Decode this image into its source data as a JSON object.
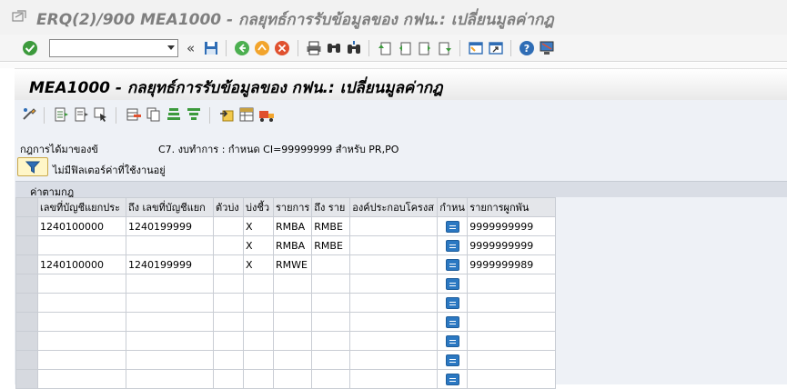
{
  "window": {
    "title": "ERQ(2)/900 MEA1000 - กลยุทธ์การรับข้อมูลของ กฟน.: เปลี่ยนมูลค่ากฎ"
  },
  "toolbar": {
    "command_field_value": "",
    "double_arrow": "«"
  },
  "screen": {
    "title": "MEA1000 - กลยุทธ์การรับข้อมูลของ กฟน.: เปลี่ยนมูลค่ากฎ"
  },
  "rule": {
    "label": "กฎการได้มาของข้",
    "value": "C7. งบทำการ : กำหนด CI=99999999 สำหรับ PR,PO"
  },
  "filter": {
    "text": "ไม่มีฟิลเตอร์ค่าที่ใช้งานอยู่"
  },
  "grid": {
    "title": "ค่าตามกฎ",
    "columns": [
      "เลขที่บัญชีแยกประ",
      "ถึง เลขที่บัญชีแยก",
      "ตัวบ่ง",
      "บ่งชี้ว",
      "รายการ",
      "ถึง ราย",
      "องค์ประกอบโครงส",
      "กำหน",
      "รายการผูกพัน"
    ],
    "rows": [
      [
        "1240100000",
        "1240199999",
        "",
        "X",
        "RMBA",
        "RMBE",
        "",
        "",
        "9999999999"
      ],
      [
        "",
        "",
        "",
        "X",
        "RMBA",
        "RMBE",
        "",
        "",
        "9999999999"
      ],
      [
        "1240100000",
        "1240199999",
        "",
        "X",
        "RMWE",
        "",
        "",
        "",
        "9999999989"
      ],
      [
        "",
        "",
        "",
        "",
        "",
        "",
        "",
        "",
        ""
      ],
      [
        "",
        "",
        "",
        "",
        "",
        "",
        "",
        "",
        ""
      ],
      [
        "",
        "",
        "",
        "",
        "",
        "",
        "",
        "",
        ""
      ],
      [
        "",
        "",
        "",
        "",
        "",
        "",
        "",
        "",
        ""
      ],
      [
        "",
        "",
        "",
        "",
        "",
        "",
        "",
        "",
        ""
      ],
      [
        "",
        "",
        "",
        "",
        "",
        "",
        "",
        "",
        ""
      ]
    ]
  },
  "colors": {
    "header_bg": "#f2f2f2",
    "panel_bg": "#eef1f6",
    "grid_header": "#e4e6ea",
    "row_button": "#2b78c2",
    "filter_button": "#fff6c8"
  }
}
